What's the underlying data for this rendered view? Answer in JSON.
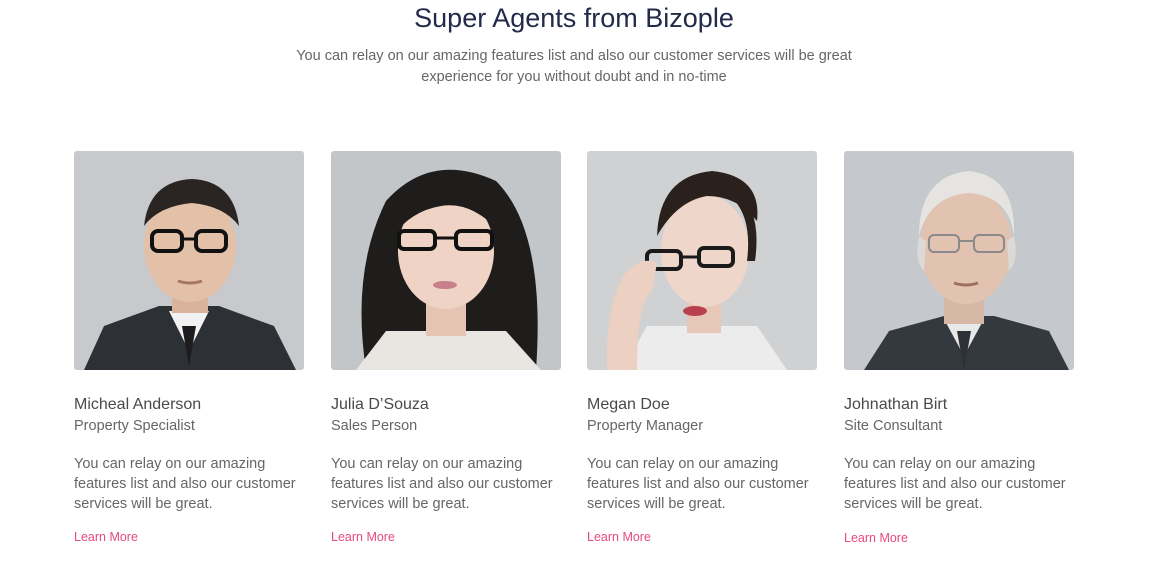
{
  "header": {
    "title": "Super Agents from Bizople",
    "subtitle_line1": "You can relay on our amazing features list and also our customer services will be great",
    "subtitle_line2": "experience for you without doubt and in no-time"
  },
  "agents": [
    {
      "name": "Micheal Anderson",
      "role": "Property Specialist",
      "description": "You can relay on our amazing features list and also our customer services will be great.",
      "link_label": "Learn More"
    },
    {
      "name": "Julia D’Souza",
      "role": "Sales Person",
      "description": "You can relay on our amazing features list and also our customer services will be great.",
      "link_label": "Learn More"
    },
    {
      "name": "Megan Doe",
      "role": "Property Manager",
      "description": "You can relay on our amazing features list and also our customer services will be great.",
      "link_label": "Learn More"
    },
    {
      "name": "Johnathan Birt",
      "role": "Site Consultant",
      "description": "You can relay on our amazing features list and also our customer services will be great.",
      "link_label": "Learn More"
    }
  ],
  "colors": {
    "title": "#232a4a",
    "link": "#e84a7a",
    "photo_background": "#c9ccd0"
  }
}
